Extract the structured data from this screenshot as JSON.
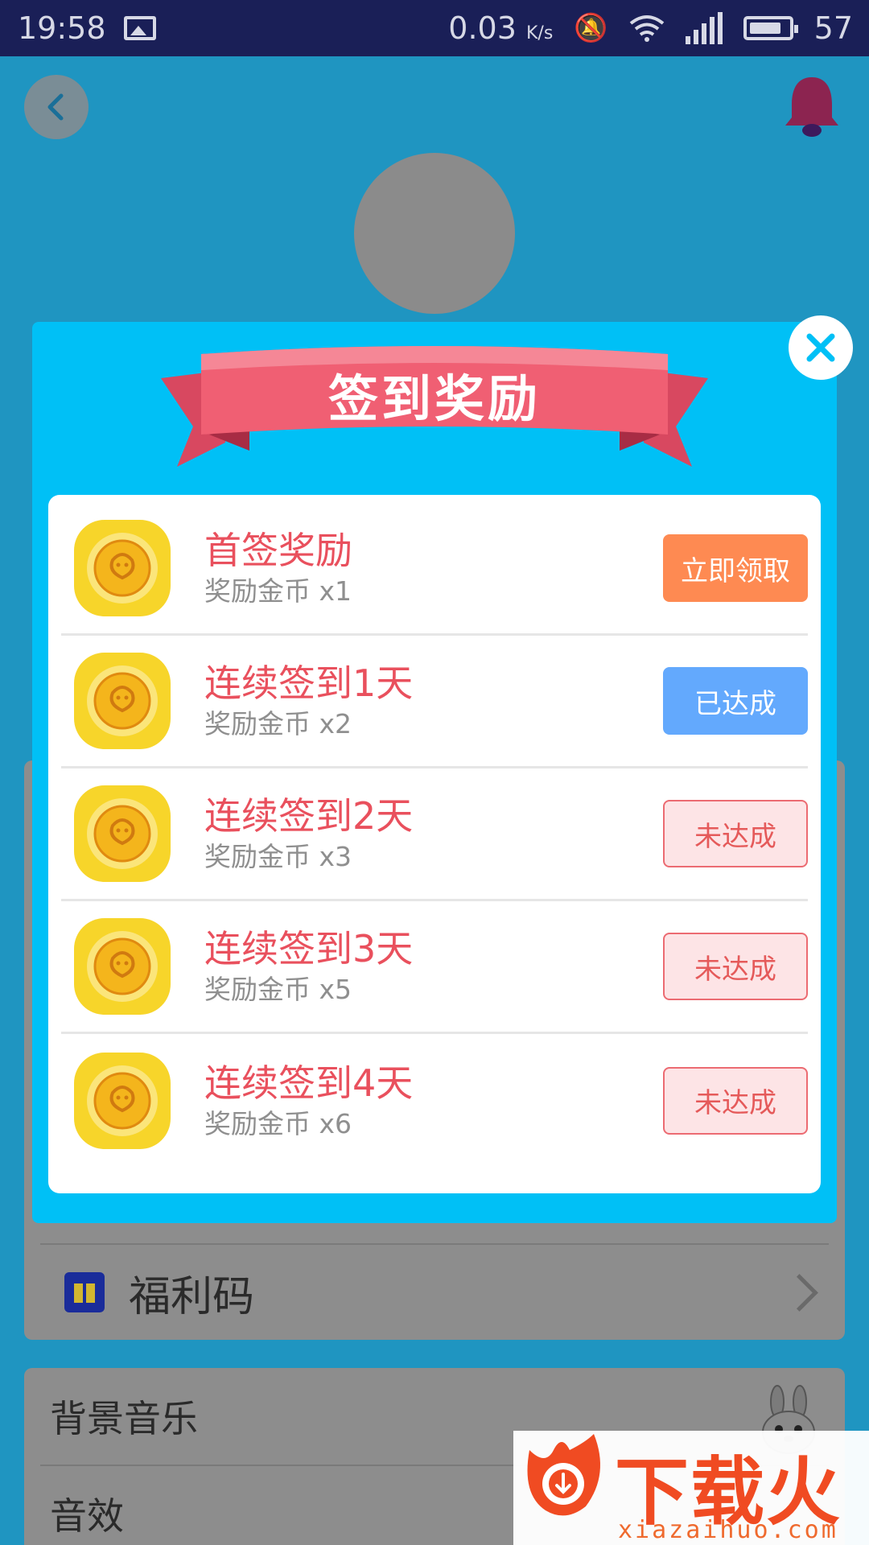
{
  "status_bar": {
    "time": "19:58",
    "speed": "0.03",
    "speed_unit": "K/s",
    "battery": "57"
  },
  "background": {
    "menu_items": [
      {
        "label": "福利码"
      },
      {
        "label": "背景音乐"
      },
      {
        "label": "音效"
      }
    ]
  },
  "dialog": {
    "title": "签到奖励",
    "rewards": [
      {
        "title": "首签奖励",
        "subtitle": "奖励金币 x1",
        "button": "立即领取",
        "state": "claim"
      },
      {
        "title": "连续签到1天",
        "subtitle": "奖励金币 x2",
        "button": "已达成",
        "state": "done"
      },
      {
        "title": "连续签到2天",
        "subtitle": "奖励金币 x3",
        "button": "未达成",
        "state": "todo"
      },
      {
        "title": "连续签到3天",
        "subtitle": "奖励金币 x5",
        "button": "未达成",
        "state": "todo"
      },
      {
        "title": "连续签到4天",
        "subtitle": "奖励金币 x6",
        "button": "未达成",
        "state": "todo"
      }
    ]
  },
  "watermark": {
    "name": "下载火",
    "url": "xiazaihuo.com"
  },
  "colors": {
    "dialog_bg": "#00c0f6",
    "title_red": "#e9505d",
    "claim_orange": "#fe8a52",
    "done_blue": "#63a9fd",
    "todo_pink": "#fde4e6"
  }
}
